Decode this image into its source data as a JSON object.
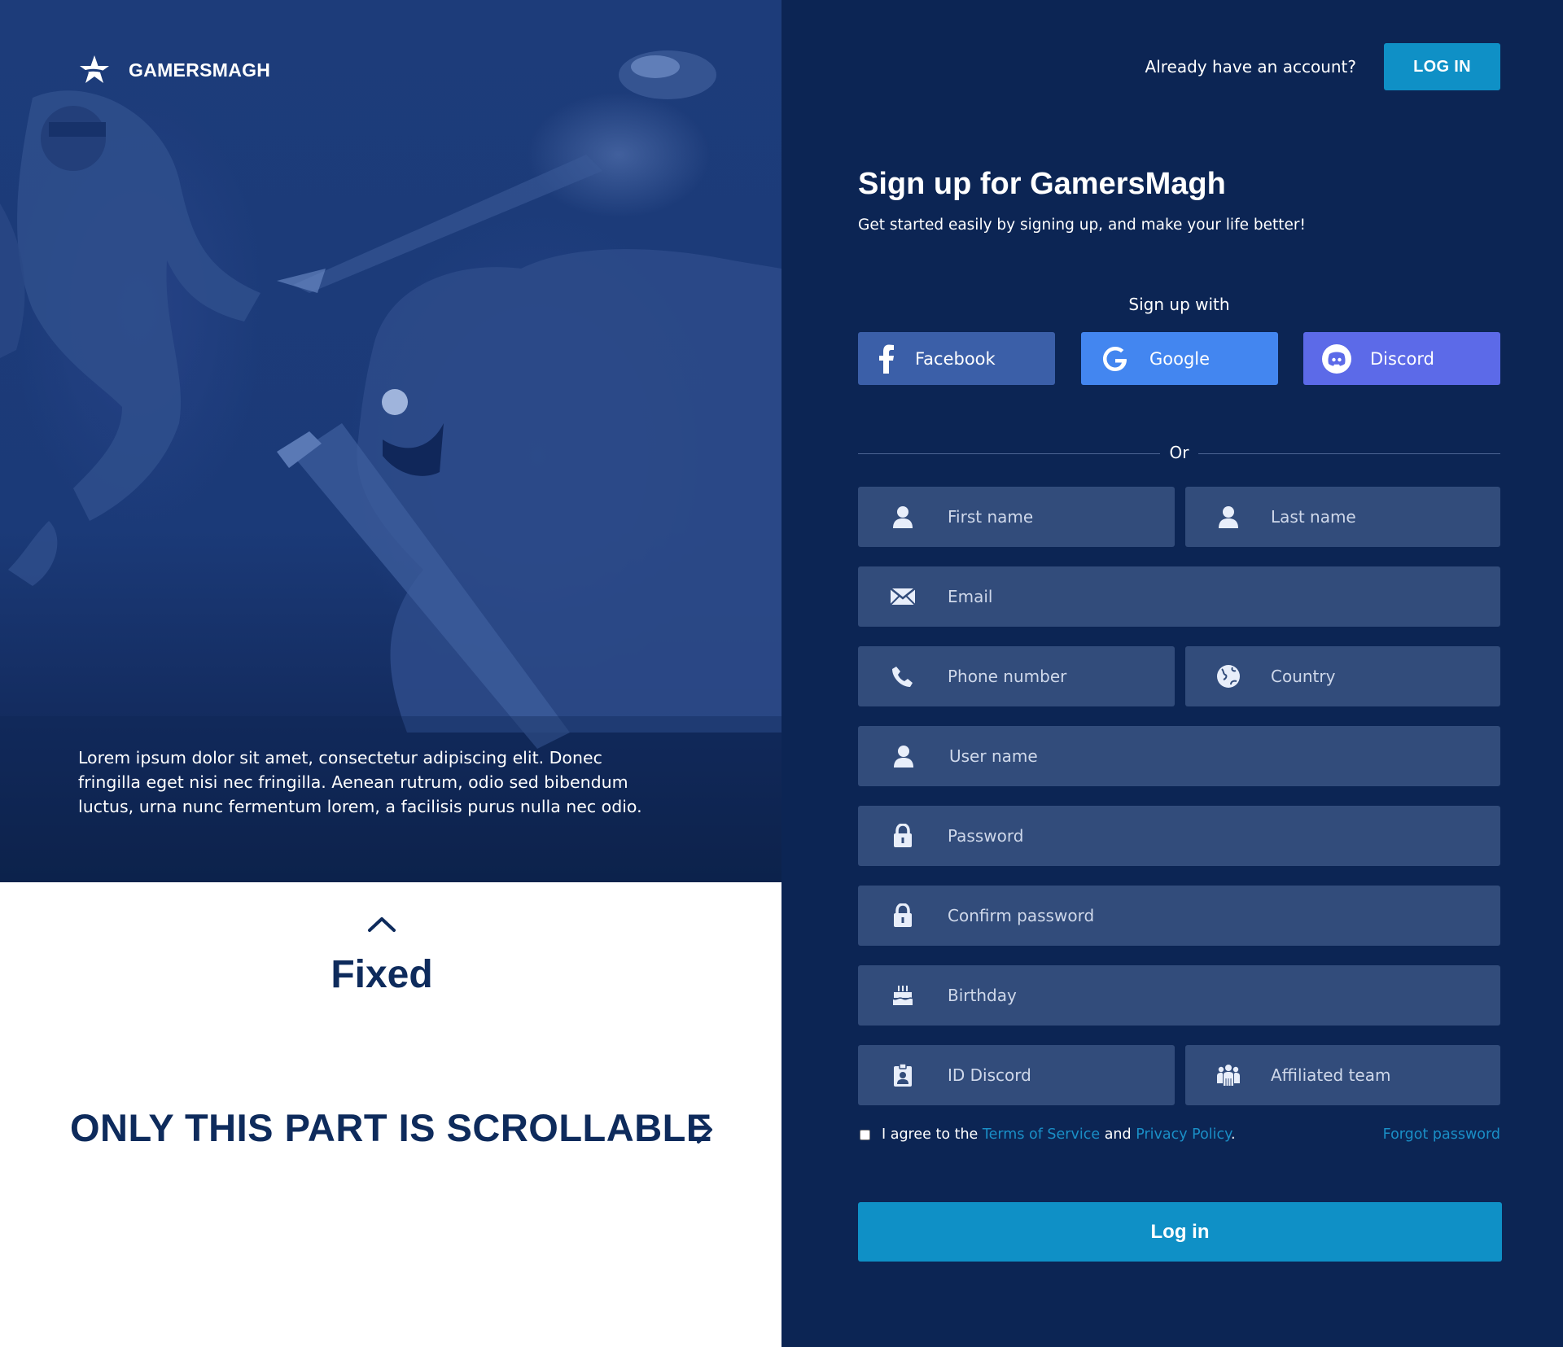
{
  "brand": {
    "name": "GAMERSMAGH",
    "logo_icon": "star-logo-icon"
  },
  "hero": {
    "text": "Lorem ipsum dolor sit amet, consectetur adipiscing elit. Donec fringilla eget nisi nec fringilla. Aenean rutrum, odio sed bibendum luctus, urna nunc fermentum lorem, a facilisis purus nulla nec odio."
  },
  "note": {
    "fixed_label": "Fixed",
    "scroll_label": "ONLY THIS PART IS SCROLLABLE",
    "up_icon": "chevron-up-icon",
    "right_icon": "chevron-right-icon"
  },
  "topbar": {
    "question": "Already have an account?",
    "login_label": "LOG IN"
  },
  "form": {
    "title": "Sign up for GamersMagh",
    "subtitle": "Get started easily by signing up, and make your life better!",
    "signup_with": "Sign up with",
    "social": [
      {
        "label": "Facebook",
        "icon": "facebook-icon",
        "color": "#3b5fa8"
      },
      {
        "label": "Google",
        "icon": "google-icon",
        "color": "#4386f0"
      },
      {
        "label": "Discord",
        "icon": "discord-icon",
        "color": "#5c6ae8"
      }
    ],
    "or": "Or",
    "fields": {
      "first_name": {
        "placeholder": "First name",
        "icon": "user-icon"
      },
      "last_name": {
        "placeholder": "Last name",
        "icon": "user-icon"
      },
      "email": {
        "placeholder": "Email",
        "icon": "envelope-icon"
      },
      "phone": {
        "placeholder": "Phone number",
        "icon": "phone-icon"
      },
      "country": {
        "placeholder": "Country",
        "icon": "globe-icon"
      },
      "username": {
        "placeholder": "User name",
        "icon": "user-icon"
      },
      "password": {
        "placeholder": "Password",
        "icon": "lock-icon"
      },
      "confirm_password": {
        "placeholder": "Confirm password",
        "icon": "lock-icon"
      },
      "birthday": {
        "placeholder": "Birthday",
        "icon": "cake-icon"
      },
      "id_discord": {
        "placeholder": "ID Discord",
        "icon": "id-badge-icon"
      },
      "team": {
        "placeholder": "Affiliated team",
        "icon": "team-icon"
      }
    },
    "agree": {
      "prefix": "I agree to the",
      "terms": "Terms of Service",
      "and": "and",
      "privacy": "Privacy Policy",
      "suffix": "."
    },
    "forgot": "Forgot password",
    "submit": "Log in"
  },
  "colors": {
    "background": "#0c2554",
    "field": "#324c7b",
    "accent": "#0f90c6",
    "link": "#1a8fc7",
    "heading_dark": "#0e2b5c"
  }
}
